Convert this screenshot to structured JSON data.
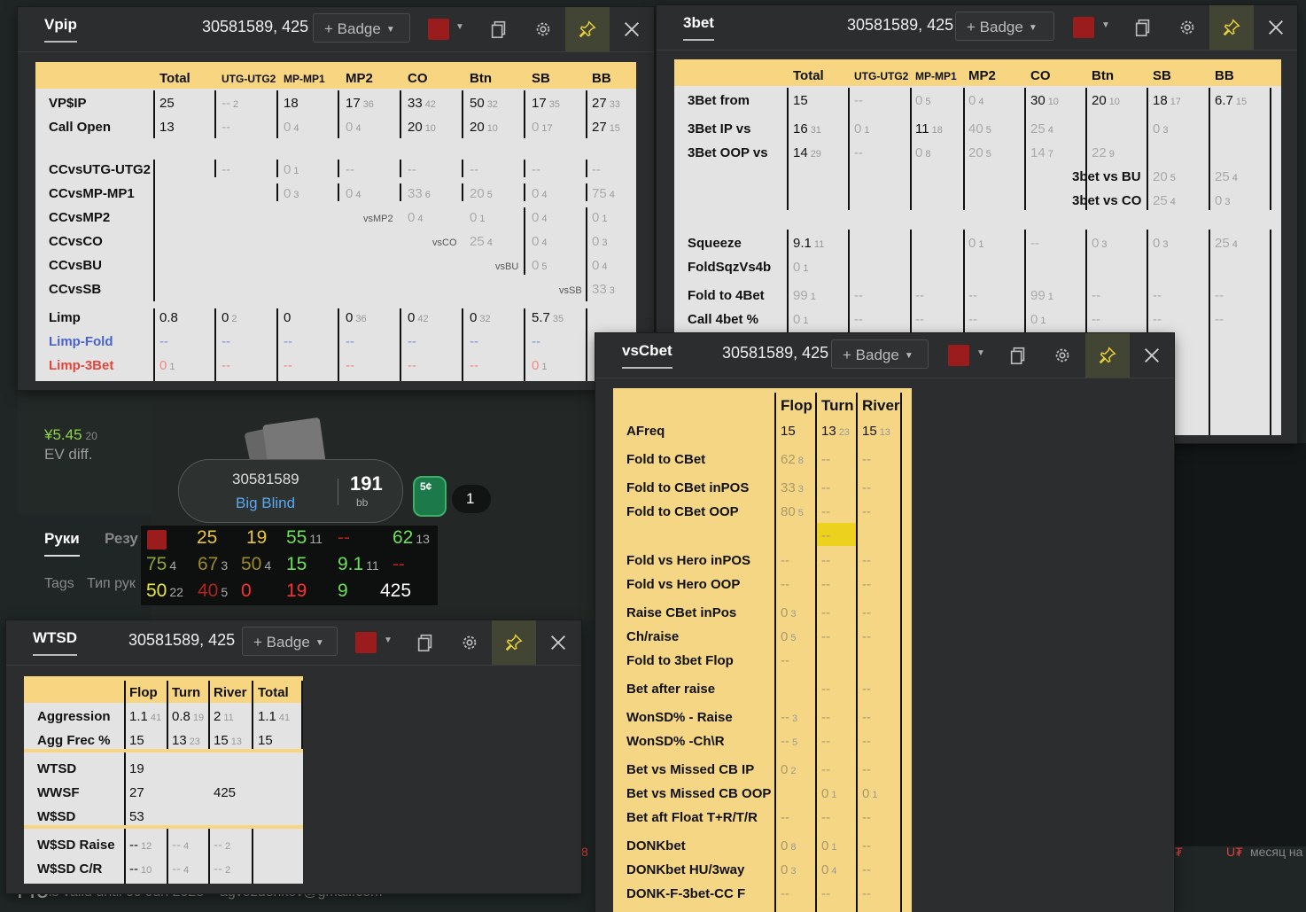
{
  "colors": {
    "header": "#f7d581",
    "table": "#e3e3e3",
    "vsbg": "#f5d684",
    "window": "#2b2d2f",
    "accent_red": "#9b1c1c",
    "pin_bg": "#434534"
  },
  "vpip": {
    "title": "Vpip",
    "player": "30581589, 425",
    "badge": "+ Badge",
    "cols": [
      "Total",
      "UTG-UTG2",
      "MP-MP1",
      "MP2",
      "CO",
      "Btn",
      "SB",
      "BB"
    ],
    "rows": {
      "vpip": {
        "label": "VP$IP",
        "v": [
          "25",
          "--",
          "18",
          "17",
          "33",
          "50",
          "17",
          "27"
        ],
        "s": [
          "",
          "2",
          "",
          "36",
          "42",
          "32",
          "35",
          "33"
        ]
      },
      "callopen": {
        "label": "Call Open",
        "v": [
          "13",
          "--",
          "0",
          "0",
          "20",
          "20",
          "0",
          "27"
        ],
        "s": [
          "",
          "",
          "4",
          "4",
          "10",
          "10",
          "17",
          "15"
        ]
      },
      "cc1": {
        "label": "CCvsUTG-UTG2",
        "v": [
          "--",
          "0",
          "--",
          "--",
          "--",
          "--",
          "--"
        ],
        "s": [
          "",
          "1",
          "",
          "",
          "",
          "",
          ""
        ]
      },
      "cc2": {
        "label": "CCvsMP-MP1",
        "v": [
          "0",
          "0",
          "33",
          "20",
          "0",
          "75"
        ],
        "s": [
          "3",
          "4",
          "6",
          "5",
          "4",
          "4"
        ]
      },
      "cc3": {
        "label": "CCvsMP2",
        "tag": "vsMP2",
        "v": [
          "0",
          "0",
          "0",
          "0"
        ],
        "s": [
          "4",
          "1",
          "4",
          "1"
        ]
      },
      "cc4": {
        "label": "CCvsCO",
        "tag": "vsCO",
        "v": [
          "25",
          "0",
          "0"
        ],
        "s": [
          "4",
          "4",
          "3"
        ]
      },
      "cc5": {
        "label": "CCvsBU",
        "tag": "vsBU",
        "v": [
          "0",
          "0"
        ],
        "s": [
          "5",
          "4"
        ]
      },
      "cc6": {
        "label": "CCvsSB",
        "tag": "vsSB",
        "v": [
          "33"
        ],
        "s": [
          "3"
        ]
      },
      "limp": {
        "label": "Limp",
        "v": [
          "0.8",
          "0",
          "0",
          "0",
          "0",
          "0",
          "5.7",
          ""
        ],
        "s": [
          "",
          "2",
          "",
          "36",
          "42",
          "32",
          "35",
          ""
        ]
      },
      "limpfold": {
        "label": "Limp-Fold",
        "v": [
          "--",
          "--",
          "--",
          "--",
          "--",
          "--",
          "--"
        ]
      },
      "limp3b": {
        "label": "Limp-3Bet",
        "v": [
          "0",
          "--",
          "--",
          "--",
          "--",
          "--",
          "0"
        ],
        "s": [
          "1",
          "",
          "",
          "",
          "",
          "",
          "1"
        ]
      }
    }
  },
  "threebet": {
    "title": "3bet",
    "player": "30581589, 425",
    "badge": "+ Badge",
    "cols": [
      "Total",
      "UTG-UTG2",
      "MP-MP1",
      "MP2",
      "CO",
      "Btn",
      "SB",
      "BB"
    ],
    "rows": {
      "from": {
        "label": "3Bet from",
        "v": [
          "15",
          "--",
          "0",
          "0",
          "30",
          "20",
          "18",
          "6.7"
        ],
        "s": [
          "",
          "",
          "5",
          "4",
          "10",
          "10",
          "17",
          "15"
        ]
      },
      "ip": {
        "label": "3Bet IP vs",
        "v": [
          "16",
          "0",
          "11",
          "40",
          "25",
          "",
          "0",
          ""
        ],
        "s": [
          "31",
          "1",
          "18",
          "5",
          "4",
          "",
          "3",
          ""
        ]
      },
      "oop": {
        "label": "3Bet OOP vs",
        "v": [
          "14",
          "--",
          "0",
          "20",
          "14",
          "22",
          "",
          ""
        ],
        "s": [
          "29",
          "",
          "8",
          "5",
          "7",
          "9",
          "",
          ""
        ]
      },
      "vsbu": {
        "label": "3bet vs BU",
        "v": [
          "20",
          "25"
        ],
        "s": [
          "5",
          "4"
        ]
      },
      "vsco": {
        "label": "3bet vs CO",
        "v": [
          "25",
          "0"
        ],
        "s": [
          "4",
          "3"
        ]
      },
      "sqz": {
        "label": "Squeeze",
        "v": [
          "9.1",
          "",
          "",
          "0",
          "--",
          "0",
          "0",
          "25"
        ],
        "s": [
          "11",
          "",
          "",
          "1",
          "",
          "3",
          "3",
          "4"
        ]
      },
      "foldsqz": {
        "label": "FoldSqzVs4b",
        "v": [
          "0"
        ],
        "s": [
          "1"
        ]
      },
      "f4b": {
        "label": "Fold to 4Bet",
        "v": [
          "99",
          "--",
          "--",
          "--",
          "99",
          "--",
          "--",
          "--"
        ],
        "s": [
          "1",
          "",
          "",
          "",
          "1",
          "",
          "",
          ""
        ]
      },
      "c4b": {
        "label": "Call 4bet %",
        "v": [
          "0",
          "--",
          "--",
          "--",
          "0",
          "--",
          "--",
          "--"
        ],
        "s": [
          "1",
          "",
          "",
          "",
          "1",
          "",
          "",
          ""
        ]
      }
    }
  },
  "vscbet": {
    "title": "vsCbet",
    "player": "30581589, 425",
    "badge": "+ Badge",
    "cols": [
      "Flop",
      "Turn",
      "River"
    ],
    "rows": [
      {
        "label": "AFreq",
        "v": [
          "15",
          "13",
          "15"
        ],
        "s": [
          "",
          "23",
          "13"
        ]
      },
      {
        "label": "Fold to CBet",
        "v": [
          "62",
          "--",
          "--"
        ],
        "s": [
          "8",
          "",
          ""
        ]
      },
      {
        "label": "Fold to CBet inPOS",
        "v": [
          "33",
          "--",
          "--"
        ],
        "s": [
          "3",
          "",
          ""
        ]
      },
      {
        "label": "Fold to CBet OOP",
        "v": [
          "80",
          "--",
          "--"
        ],
        "s": [
          "5",
          "",
          ""
        ]
      },
      {
        "label": "",
        "v": [
          "",
          "--",
          ""
        ],
        "s": [
          "",
          "",
          ""
        ]
      },
      {
        "label": "Fold vs Hero inPOS",
        "v": [
          "--",
          "--",
          "--"
        ],
        "s": [
          "",
          "",
          ""
        ]
      },
      {
        "label": "Fold vs Hero OOP",
        "v": [
          "--",
          "--",
          "--"
        ],
        "s": [
          "",
          "",
          ""
        ]
      },
      {
        "label": "Raise CBet inPos",
        "v": [
          "0",
          "--",
          "--"
        ],
        "s": [
          "3",
          "",
          ""
        ]
      },
      {
        "label": "Ch/raise",
        "v": [
          "0",
          "--",
          "--"
        ],
        "s": [
          "5",
          "",
          ""
        ]
      },
      {
        "label": "Fold to 3bet Flop",
        "v": [
          "--",
          "",
          ""
        ],
        "s": [
          "",
          "",
          ""
        ]
      },
      {
        "label": "Bet after raise",
        "v": [
          "",
          "--",
          "--"
        ],
        "s": [
          "",
          "",
          ""
        ]
      },
      {
        "label": "WonSD% - Raise",
        "v": [
          "--",
          "--",
          "--"
        ],
        "s": [
          "3",
          "",
          ""
        ]
      },
      {
        "label": "WonSD% -Ch\\R",
        "v": [
          "--",
          "--",
          "--"
        ],
        "s": [
          "5",
          "",
          ""
        ]
      },
      {
        "label": "Bet vs Missed CB IP",
        "v": [
          "0",
          "--",
          "--"
        ],
        "s": [
          "2",
          "",
          ""
        ]
      },
      {
        "label": "Bet vs Missed CB OOP",
        "v": [
          "",
          "0",
          "0"
        ],
        "s": [
          "",
          "1",
          "1"
        ]
      },
      {
        "label": "Bet aft Float T+R/T/R",
        "v": [
          "--",
          "--",
          "--"
        ],
        "s": [
          "",
          "",
          ""
        ]
      },
      {
        "label": "DONKbet",
        "v": [
          "0",
          "0",
          "--"
        ],
        "s": [
          "8",
          "1",
          ""
        ]
      },
      {
        "label": "DONKbet HU/3way",
        "v": [
          "0",
          "0",
          "--"
        ],
        "s": [
          "3",
          "4",
          ""
        ]
      },
      {
        "label": "DONK-F-3bet-CC F",
        "v": [
          "--",
          "--",
          "--"
        ],
        "s": [
          "",
          "",
          ""
        ]
      }
    ]
  },
  "wtsd": {
    "title": "WTSD",
    "player": "30581589, 425",
    "badge": "+ Badge",
    "cols": [
      "Flop",
      "Turn",
      "River",
      "Total"
    ],
    "rows": {
      "agg": {
        "label": "Aggression",
        "v": [
          "1.1",
          "0.8",
          "2",
          "1.1"
        ],
        "s": [
          "41",
          "19",
          "11",
          "41"
        ]
      },
      "aggf": {
        "label": "Agg Frec %",
        "v": [
          "15",
          "13",
          "15",
          "15"
        ],
        "s": [
          "",
          "23",
          "13",
          ""
        ]
      },
      "wtsd": {
        "label": "WTSD",
        "v": [
          "19"
        ]
      },
      "wwsf": {
        "label": "WWSF",
        "v": [
          "27",
          "425"
        ]
      },
      "wsd": {
        "label": "W$SD",
        "v": [
          "53"
        ]
      },
      "wsdr": {
        "label": "W$SD Raise",
        "v": [
          "--",
          "--",
          "--"
        ],
        "s": [
          "12",
          "4",
          "2"
        ]
      },
      "wsdcr": {
        "label": "W$SD C/R",
        "v": [
          "--",
          "--",
          "--"
        ],
        "s": [
          "10",
          "4",
          "2"
        ]
      }
    }
  },
  "background": {
    "ev_value": "¥5.45",
    "ev_count": "20",
    "ev_label": "EV diff.",
    "player_id": "30581589",
    "position": "Big Blind",
    "stack": "191",
    "stack_unit": "bb",
    "chip": "5¢",
    "seat_count": "1",
    "tab_hands": "Руки",
    "tab_results": "Резу",
    "filter_tags": "Tags",
    "filter_type": "Тип рук",
    "footer_a": "PTO",
    "footer_b": "is valid until 09 Jun 2025",
    "footer_c": "agvozdenkov@gmail.com",
    "right_a": "U₮",
    "right_b": "месяц на",
    "right_c": "₮",
    "left_8": "8"
  },
  "hud": {
    "r1": [
      {
        "v": "25",
        "c": "#e8c53a"
      },
      {
        "v": "19",
        "c": "#e8c53a"
      },
      {
        "v": "55",
        "c": "#6ee05a",
        "s": "11"
      },
      {
        "v": "--",
        "c": "#b0241e"
      },
      {
        "v": "62",
        "c": "#6ee05a",
        "s": "13"
      }
    ],
    "r2": [
      {
        "v": "75",
        "c": "#8aa53a",
        "s": "4"
      },
      {
        "v": "67",
        "c": "#9a8a2a",
        "s": "3"
      },
      {
        "v": "50",
        "c": "#9a8a2a",
        "s": "4"
      },
      {
        "v": "15",
        "c": "#6ee05a"
      },
      {
        "v": "9.1",
        "c": "#6ee05a",
        "s": "11"
      },
      {
        "v": "--",
        "c": "#b0241e"
      }
    ],
    "r3": [
      {
        "v": "50",
        "c": "#e8e83a",
        "s": "22"
      },
      {
        "v": "40",
        "c": "#b0241e",
        "s": "5"
      },
      {
        "v": "0",
        "c": "#ff3030"
      },
      {
        "v": "19",
        "c": "#ff3030"
      },
      {
        "v": "9",
        "c": "#6ee05a"
      },
      {
        "v": "425",
        "c": "#ffffff"
      }
    ]
  }
}
